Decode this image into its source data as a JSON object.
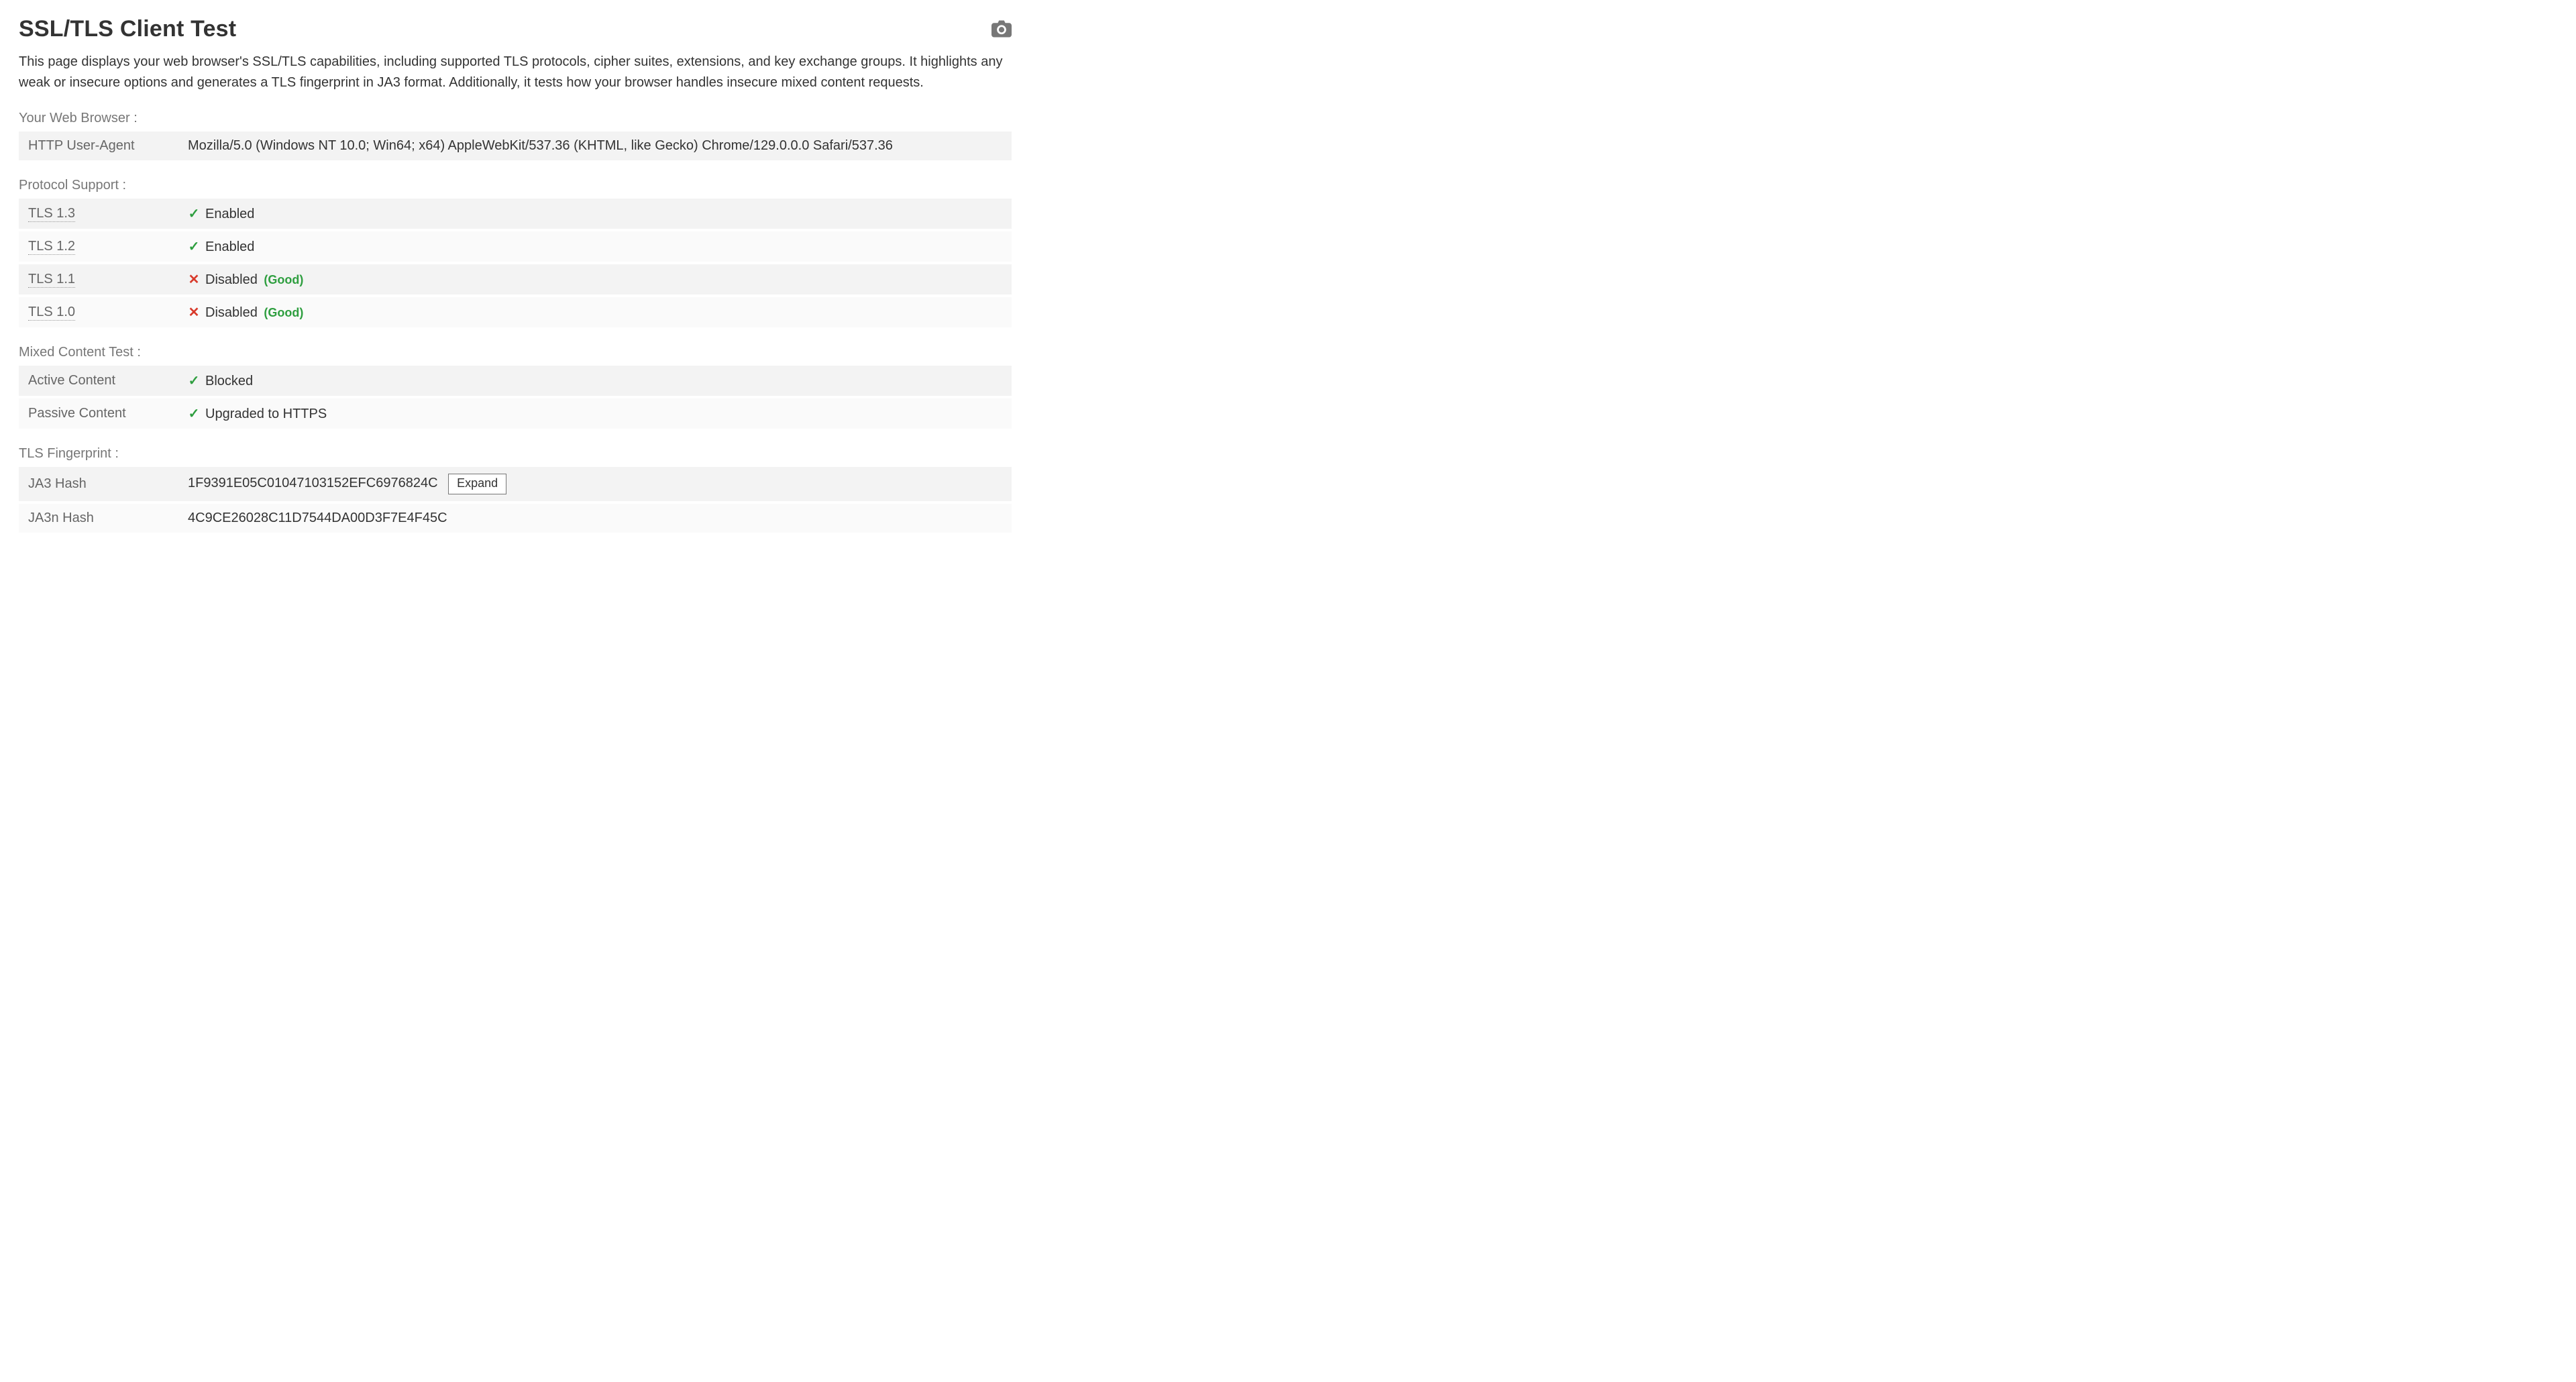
{
  "title": "SSL/TLS Client Test",
  "intro": "This page displays your web browser's SSL/TLS capabilities, including supported TLS protocols, cipher suites, extensions, and key exchange groups. It highlights any weak or insecure options and generates a TLS fingerprint in JA3 format. Additionally, it tests how your browser handles insecure mixed content requests.",
  "icons": {
    "check": "✓",
    "cross": "✕"
  },
  "browser": {
    "section_label": "Your Web Browser :",
    "rows": [
      {
        "key": "HTTP User-Agent",
        "value": "Mozilla/5.0 (Windows NT 10.0; Win64; x64) AppleWebKit/537.36 (KHTML, like Gecko) Chrome/129.0.0.0 Safari/537.36"
      }
    ]
  },
  "protocol": {
    "section_label": "Protocol Support :",
    "rows": [
      {
        "key": "TLS 1.3",
        "status": "ok",
        "value": "Enabled",
        "note": ""
      },
      {
        "key": "TLS 1.2",
        "status": "ok",
        "value": "Enabled",
        "note": ""
      },
      {
        "key": "TLS 1.1",
        "status": "bad",
        "value": "Disabled",
        "note": "(Good)"
      },
      {
        "key": "TLS 1.0",
        "status": "bad",
        "value": "Disabled",
        "note": "(Good)"
      }
    ]
  },
  "mixed": {
    "section_label": "Mixed Content Test :",
    "rows": [
      {
        "key": "Active Content",
        "status": "ok",
        "value": "Blocked"
      },
      {
        "key": "Passive Content",
        "status": "ok",
        "value": "Upgraded to HTTPS"
      }
    ]
  },
  "fingerprint": {
    "section_label": "TLS Fingerprint :",
    "rows": [
      {
        "key": "JA3 Hash",
        "value": "1F9391E05C01047103152EFC6976824C",
        "expand_label": "Expand"
      },
      {
        "key": "JA3n Hash",
        "value": "4C9CE26028C11D7544DA00D3F7E4F45C"
      }
    ]
  }
}
